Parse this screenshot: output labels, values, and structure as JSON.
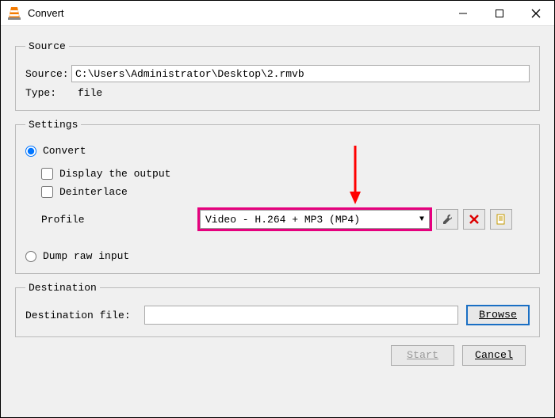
{
  "window": {
    "title": "Convert"
  },
  "source": {
    "legend": "Source",
    "source_label": "Source:",
    "source_value": "C:\\Users\\Administrator\\Desktop\\2.rmvb",
    "type_label": "Type:",
    "type_value": "file"
  },
  "settings": {
    "legend": "Settings",
    "convert_label": "Convert",
    "display_output_label": "Display the output",
    "deinterlace_label": "Deinterlace",
    "profile_label": "Profile",
    "profile_value": "Video - H.264 + MP3 (MP4)",
    "dump_raw_label": "Dump raw input"
  },
  "destination": {
    "legend": "Destination",
    "dest_file_label": "Destination file:",
    "browse_label": "Browse"
  },
  "buttons": {
    "start": "Start",
    "cancel": "Cancel"
  }
}
